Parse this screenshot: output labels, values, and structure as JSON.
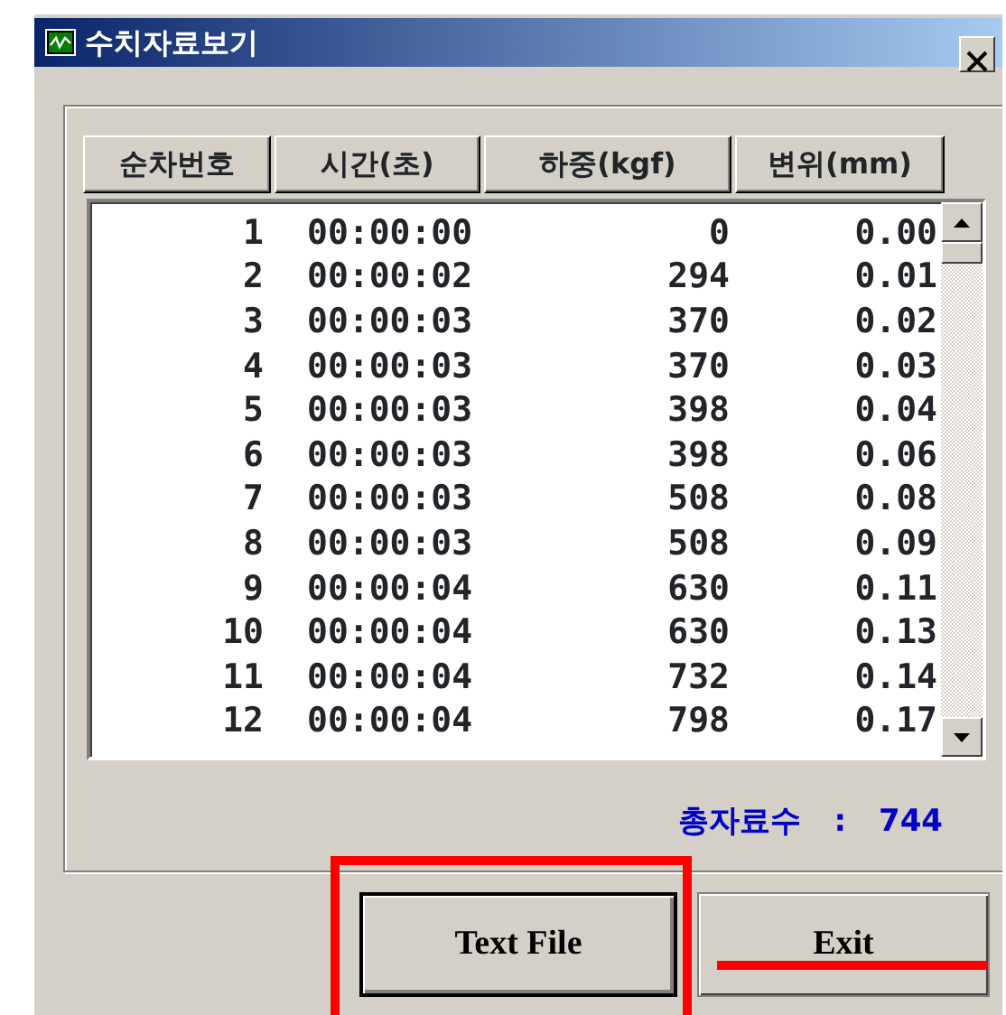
{
  "window": {
    "title": "수치자료보기"
  },
  "table": {
    "columns": [
      "순차번호",
      "시간(초)",
      "하중(kgf)",
      "변위(mm)"
    ],
    "rows": [
      {
        "cells": [
          "1",
          "00:00:00",
          "0",
          "0.00"
        ]
      },
      {
        "cells": [
          "2",
          "00:00:02",
          "294",
          "0.01"
        ]
      },
      {
        "cells": [
          "3",
          "00:00:03",
          "370",
          "0.02"
        ]
      },
      {
        "cells": [
          "4",
          "00:00:03",
          "370",
          "0.03"
        ]
      },
      {
        "cells": [
          "5",
          "00:00:03",
          "398",
          "0.04"
        ]
      },
      {
        "cells": [
          "6",
          "00:00:03",
          "398",
          "0.06"
        ]
      },
      {
        "cells": [
          "7",
          "00:00:03",
          "508",
          "0.08"
        ]
      },
      {
        "cells": [
          "8",
          "00:00:03",
          "508",
          "0.09"
        ]
      },
      {
        "cells": [
          "9",
          "00:00:04",
          "630",
          "0.11"
        ]
      },
      {
        "cells": [
          "10",
          "00:00:04",
          "630",
          "0.13"
        ]
      },
      {
        "cells": [
          "11",
          "00:00:04",
          "732",
          "0.14"
        ]
      },
      {
        "cells": [
          "12",
          "00:00:04",
          "798",
          "0.17"
        ]
      }
    ]
  },
  "total": {
    "label": "총자료수",
    "separator": ":",
    "value": "744"
  },
  "buttons": [
    {
      "label": "Text File",
      "highlighted": true,
      "struck_through": false
    },
    {
      "label": "Exit",
      "highlighted": false,
      "struck_through": true
    }
  ]
}
